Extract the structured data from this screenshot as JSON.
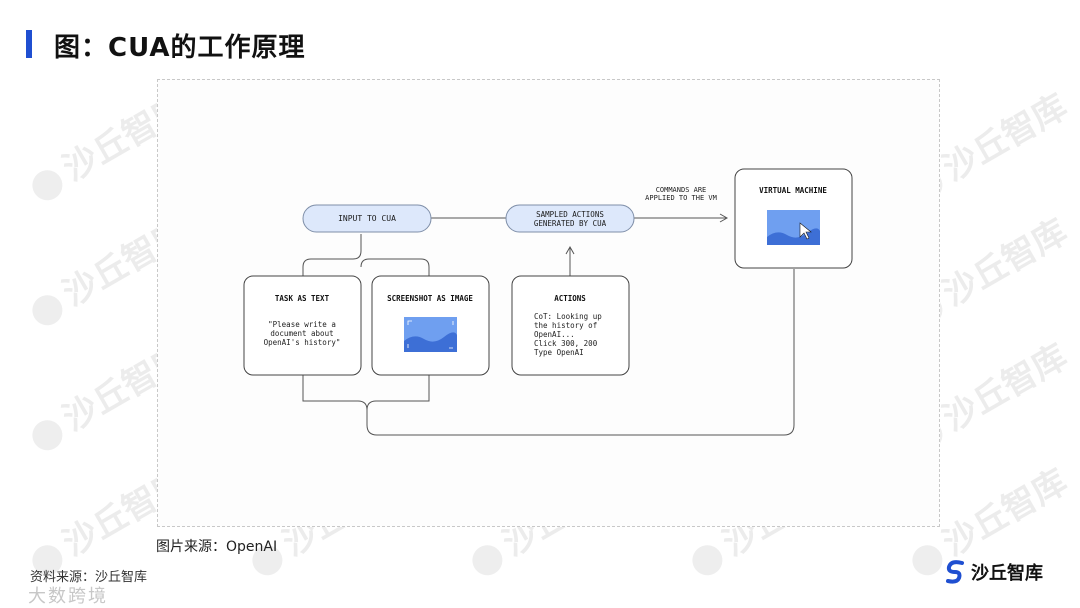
{
  "header": {
    "title": "图：CUA的工作原理"
  },
  "diagram": {
    "input_to_cua": "INPUT TO CUA",
    "sampled_actions_line1": "SAMPLED ACTIONS",
    "sampled_actions_line2": "GENERATED BY CUA",
    "commands_line1": "COMMANDS ARE",
    "commands_line2": "APPLIED TO THE VM",
    "vm_title": "VIRTUAL MACHINE",
    "task_title": "TASK AS TEXT",
    "task_quote": [
      "\"Please write a",
      "document about",
      "OpenAI's history\""
    ],
    "screenshot_title": "SCREENSHOT AS IMAGE",
    "actions_title": "ACTIONS",
    "actions_lines": [
      "CoT: Looking up",
      "the history of",
      "OpenAI...",
      "Click 300, 200",
      "Type OpenAI"
    ],
    "accent_fill": "#dde8fb",
    "image_fill": "#6f9ff0"
  },
  "source": "图片来源：OpenAI",
  "footer": {
    "left": "资料来源：沙丘智库",
    "left_watermark": "大数跨境",
    "brand": "沙丘智库"
  },
  "watermark": "沙丘智库"
}
